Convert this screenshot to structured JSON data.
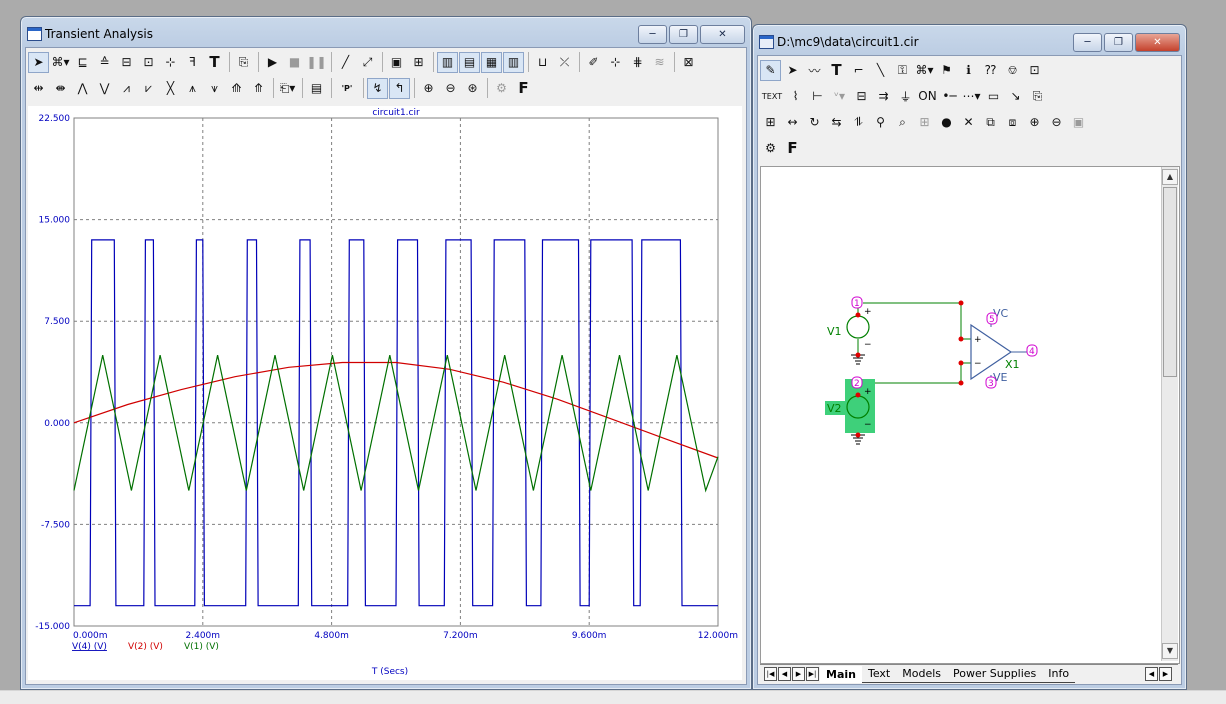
{
  "left_window": {
    "title": "Transient Analysis",
    "window_buttons": [
      "─",
      "❐",
      "✕"
    ],
    "toolbar_row1": [
      {
        "icon": "select-arrow-icon",
        "glyph": "➤",
        "pressed": true
      },
      {
        "icon": "scale-dropdown-icon",
        "glyph": "⌘▾"
      },
      {
        "icon": "graph-text-icon",
        "glyph": "⊑"
      },
      {
        "icon": "tag-icon",
        "glyph": "≙"
      },
      {
        "icon": "box-icon",
        "glyph": "⊟"
      },
      {
        "icon": "draw-tag-icon",
        "glyph": "⊡"
      },
      {
        "icon": "point-tag-icon",
        "glyph": "⊹"
      },
      {
        "icon": "font-tag-icon",
        "glyph": "ꟻ"
      },
      {
        "icon": "text-tool-icon",
        "glyph": "T",
        "big": true
      },
      {
        "sep": true
      },
      {
        "icon": "properties-icon",
        "glyph": "⎘"
      },
      {
        "sep": true
      },
      {
        "icon": "run-icon",
        "glyph": "▶"
      },
      {
        "icon": "stop-icon",
        "glyph": "■",
        "grey": true
      },
      {
        "icon": "pause-icon",
        "glyph": "❚❚",
        "grey": true
      },
      {
        "sep": true
      },
      {
        "icon": "line-icon",
        "glyph": "╱"
      },
      {
        "icon": "slope-icon",
        "glyph": "⤢"
      },
      {
        "sep": true
      },
      {
        "icon": "frame-icon",
        "glyph": "▣"
      },
      {
        "icon": "grid-icon",
        "glyph": "⊞"
      },
      {
        "sep": true
      },
      {
        "icon": "vertical-grid-icon",
        "glyph": "▥",
        "pressed": true
      },
      {
        "icon": "horizontal-grid-icon",
        "glyph": "▤",
        "pressed": true
      },
      {
        "icon": "minor-grid-icon",
        "glyph": "▦",
        "pressed": true
      },
      {
        "icon": "minor-v-grid-icon",
        "glyph": "▥",
        "pressed": true
      },
      {
        "sep": true
      },
      {
        "icon": "baseline-icon",
        "glyph": "⊔"
      },
      {
        "icon": "cursor-line-icon",
        "glyph": "⤫"
      },
      {
        "sep": true
      },
      {
        "icon": "peak-icon",
        "glyph": "✐"
      },
      {
        "icon": "valley-icon",
        "glyph": "⊹"
      },
      {
        "icon": "slope-marker-icon",
        "glyph": "⋕"
      },
      {
        "icon": "wave-icon",
        "glyph": "≋",
        "grey": true
      },
      {
        "sep": true
      },
      {
        "icon": "remove-cursor-icon",
        "glyph": "⊠"
      }
    ],
    "toolbar_row2": [
      {
        "icon": "cursor-left-icon",
        "glyph": "⇹"
      },
      {
        "icon": "cursor-right-icon",
        "glyph": "⇼"
      },
      {
        "icon": "peak-search-icon",
        "glyph": "⋀"
      },
      {
        "icon": "valley-search-icon",
        "glyph": "⋁"
      },
      {
        "icon": "high-icon",
        "glyph": "⩘"
      },
      {
        "icon": "low-icon",
        "glyph": "⩗"
      },
      {
        "icon": "inflection-icon",
        "glyph": "╳"
      },
      {
        "icon": "global-high-icon",
        "glyph": "⩚"
      },
      {
        "icon": "global-low-icon",
        "glyph": "⩛"
      },
      {
        "icon": "top-icon",
        "glyph": "⟰"
      },
      {
        "icon": "bottom-icon",
        "glyph": "⤊"
      },
      {
        "sep": true
      },
      {
        "icon": "animate-icon",
        "glyph": "⎗▾"
      },
      {
        "sep": true
      },
      {
        "icon": "data-table-icon",
        "glyph": "▤"
      },
      {
        "sep": true
      },
      {
        "icon": "plot-p-icon",
        "glyph": "'P'",
        "big": true
      },
      {
        "sep": true
      },
      {
        "icon": "x-cursor-icon",
        "glyph": "↯",
        "pressed": true
      },
      {
        "icon": "y-cursor-icon",
        "glyph": "↰",
        "pressed": true
      },
      {
        "sep": true
      },
      {
        "icon": "zoom-in-icon",
        "glyph": "⊕"
      },
      {
        "icon": "zoom-out-icon",
        "glyph": "⊖"
      },
      {
        "icon": "zoom-fit-icon",
        "glyph": "⊛"
      },
      {
        "sep": true
      },
      {
        "icon": "options-icon",
        "glyph": "⚙",
        "grey": true
      },
      {
        "icon": "font-icon",
        "glyph": "F",
        "big": true
      }
    ]
  },
  "chart_data": {
    "type": "line",
    "title": "circuit1.cir",
    "xlabel": "T (Secs)",
    "ylabel": "",
    "xlim": [
      0,
      0.012
    ],
    "ylim": [
      -15,
      22.5
    ],
    "x_ticks": [
      "0.000m",
      "2.400m",
      "4.800m",
      "7.200m",
      "9.600m",
      "12.000m"
    ],
    "y_ticks": [
      "22.500",
      "15.000",
      "7.500",
      "0.000",
      "-7.500",
      "-15.000"
    ],
    "grid": true,
    "series": [
      {
        "name": "V(4) (V)",
        "color": "#0000b8",
        "description_values": {
          "high": 13.5,
          "low": -13.5,
          "x": [
            0.0,
            0.0003,
            0.00033,
            0.00075,
            0.00078,
            0.0013,
            0.00133,
            0.00148,
            0.00151,
            0.00225,
            0.00228,
            0.0024,
            0.00243,
            0.0032,
            0.00323,
            0.0034,
            0.00343,
            0.00418,
            0.00421,
            0.0044,
            0.00443,
            0.0051,
            0.00513,
            0.0054,
            0.00543,
            0.006,
            0.00603,
            0.0064,
            0.00643,
            0.0069,
            0.00693,
            0.0074,
            0.00743,
            0.0078,
            0.00783,
            0.0084,
            0.00843,
            0.0087,
            0.00873,
            0.0094,
            0.00943,
            0.0096,
            0.00963,
            0.0104,
            0.01043,
            0.01055,
            0.01058,
            0.0113,
            0.01133,
            0.01195,
            0.012
          ],
          "y": [
            -13.5,
            -13.5,
            13.5,
            13.5,
            -13.5,
            -13.5,
            13.5,
            13.5,
            -13.5,
            -13.5,
            13.5,
            13.5,
            -13.5,
            -13.5,
            13.5,
            13.5,
            -13.5,
            -13.5,
            13.5,
            13.5,
            -13.5,
            -13.5,
            13.5,
            13.5,
            -13.5,
            -13.5,
            13.5,
            13.5,
            -13.5,
            -13.5,
            13.5,
            13.5,
            -13.5,
            -13.5,
            13.5,
            13.5,
            -13.5,
            -13.5,
            13.5,
            13.5,
            -13.5,
            -13.5,
            13.5,
            13.5,
            -13.5,
            -13.5,
            13.5,
            13.5,
            -13.5,
            -13.5,
            -13.5
          ]
        }
      },
      {
        "name": "V(2) (V)",
        "color": "#d00000",
        "description_values": {
          "x": [
            0,
            0.001,
            0.002,
            0.003,
            0.004,
            0.005,
            0.006,
            0.007,
            0.008,
            0.009,
            0.01,
            0.011,
            0.012
          ],
          "y": [
            0,
            1.35,
            2.45,
            3.4,
            4.1,
            4.45,
            4.45,
            3.95,
            3.0,
            1.75,
            0.3,
            -1.15,
            -2.6
          ]
        }
      },
      {
        "name": "V(1) (V)",
        "color": "#007000",
        "description_values": {
          "amplitude": 5.0,
          "period": 0.00107,
          "x": [
            0,
            0.000535,
            0.00107,
            0.001605,
            0.00214,
            0.002675,
            0.00321,
            0.003745,
            0.00428,
            0.004815,
            0.00535,
            0.005885,
            0.00642,
            0.006955,
            0.00749,
            0.008025,
            0.00856,
            0.009095,
            0.00963,
            0.010165,
            0.0107,
            0.011235,
            0.01177,
            0.012
          ],
          "y": [
            -5,
            5,
            -5,
            5,
            -5,
            5,
            -5,
            5,
            -5,
            5,
            -5,
            5,
            -5,
            5,
            -5,
            5,
            -5,
            5,
            -5,
            5,
            -5,
            5,
            -5,
            -2.5
          ]
        }
      }
    ]
  },
  "right_window": {
    "title": "D:\\mc9\\data\\circuit1.cir",
    "window_buttons": [
      "─",
      "❐",
      "✕"
    ],
    "toolbar_row1": [
      {
        "icon": "component-mode-icon",
        "glyph": "✎",
        "pressed": true
      },
      {
        "icon": "select-mode-icon",
        "glyph": "➤"
      },
      {
        "icon": "wire-mode-icon",
        "glyph": "〰"
      },
      {
        "icon": "text-mode-icon",
        "glyph": "T",
        "big": true
      },
      {
        "icon": "wire-icon",
        "glyph": "⌐"
      },
      {
        "icon": "diagonal-wire-icon",
        "glyph": "╲"
      },
      {
        "icon": "bus-icon",
        "glyph": "⚿"
      },
      {
        "icon": "graphics-dropdown-icon",
        "glyph": "⌘▾"
      },
      {
        "icon": "flag-icon",
        "glyph": "⚑"
      },
      {
        "icon": "info-icon",
        "glyph": "ℹ"
      },
      {
        "icon": "help-icon",
        "glyph": "⁇"
      },
      {
        "icon": "point-icon",
        "glyph": "⎊"
      },
      {
        "icon": "probe-icon",
        "glyph": "⊡"
      }
    ],
    "toolbar_row2": [
      {
        "icon": "text-icon",
        "glyph": "TEXT"
      },
      {
        "icon": "node-numbers-icon",
        "glyph": "⌇"
      },
      {
        "icon": "pin-icon",
        "glyph": "⊢"
      },
      {
        "icon": "voltage-icon",
        "glyph": "ᵛ▾",
        "grey": true
      },
      {
        "icon": "attribute-icon",
        "glyph": "⊟"
      },
      {
        "icon": "pin-connections-icon",
        "glyph": "⇉"
      },
      {
        "icon": "power-icon",
        "glyph": "⏚"
      },
      {
        "icon": "on-icon",
        "glyph": "ON"
      },
      {
        "icon": "wire-dots-icon",
        "glyph": "•─"
      },
      {
        "icon": "grid-dots-icon",
        "glyph": "⋯▾"
      },
      {
        "icon": "border-icon",
        "glyph": "▭"
      },
      {
        "icon": "cursor-icon",
        "glyph": "↘"
      },
      {
        "icon": "properties-icon",
        "glyph": "⎘"
      }
    ],
    "toolbar_row3": [
      {
        "icon": "page-icon",
        "glyph": "⊞"
      },
      {
        "icon": "mirror-icon",
        "glyph": "↔"
      },
      {
        "icon": "rotate-icon",
        "glyph": "↻"
      },
      {
        "icon": "flip-icon",
        "glyph": "⇆"
      },
      {
        "icon": "flip-v-icon",
        "glyph": "⥮"
      },
      {
        "icon": "find-icon",
        "glyph": "⚲"
      },
      {
        "icon": "binoculars-icon",
        "glyph": "⌕"
      },
      {
        "icon": "display-icon",
        "glyph": "⊞",
        "grey": true
      },
      {
        "icon": "go-icon",
        "glyph": "●"
      },
      {
        "icon": "cancel-icon",
        "glyph": "✕"
      },
      {
        "icon": "copy-icon",
        "glyph": "⧉"
      },
      {
        "icon": "paste-icon",
        "glyph": "⧈"
      },
      {
        "icon": "zoom-in-icon",
        "glyph": "⊕"
      },
      {
        "icon": "zoom-out-icon",
        "glyph": "⊖"
      },
      {
        "icon": "camera-icon",
        "glyph": "▣",
        "grey": true
      }
    ],
    "toolbar_row4": [
      {
        "icon": "global-settings-icon",
        "glyph": "⚙"
      },
      {
        "icon": "font-icon",
        "glyph": "F",
        "big": true
      }
    ],
    "schematic": {
      "labels": {
        "v1": "V1",
        "v2": "V2",
        "x1": "X1",
        "vc": "VC",
        "ve": "VE",
        "node1": "1",
        "node2": "2",
        "node3": "3",
        "node4": "4",
        "node5": "5",
        "plus": "+",
        "minus": "−"
      },
      "wire_color": "#008000",
      "selection_color": "#33cc77"
    },
    "tabs": [
      "Main",
      "Text",
      "Models",
      "Power Supplies",
      "Info"
    ],
    "active_tab": "Main"
  }
}
